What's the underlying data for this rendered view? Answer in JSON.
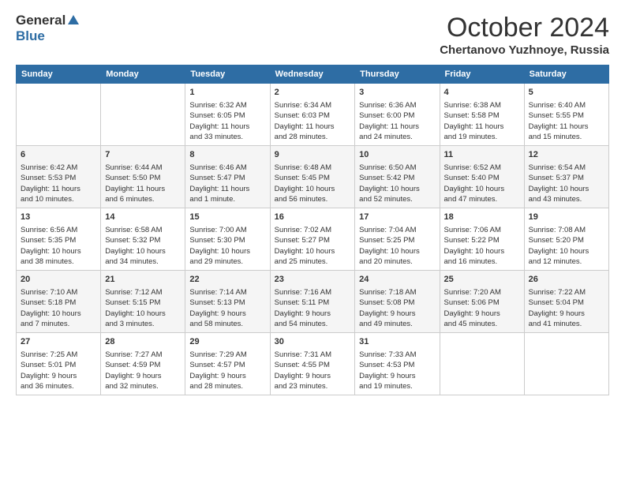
{
  "header": {
    "logo_general": "General",
    "logo_blue": "Blue",
    "month_title": "October 2024",
    "location": "Chertanovo Yuzhnoye, Russia"
  },
  "calendar": {
    "days_of_week": [
      "Sunday",
      "Monday",
      "Tuesday",
      "Wednesday",
      "Thursday",
      "Friday",
      "Saturday"
    ],
    "weeks": [
      [
        {
          "day": "",
          "info": ""
        },
        {
          "day": "",
          "info": ""
        },
        {
          "day": "1",
          "info": "Sunrise: 6:32 AM\nSunset: 6:05 PM\nDaylight: 11 hours\nand 33 minutes."
        },
        {
          "day": "2",
          "info": "Sunrise: 6:34 AM\nSunset: 6:03 PM\nDaylight: 11 hours\nand 28 minutes."
        },
        {
          "day": "3",
          "info": "Sunrise: 6:36 AM\nSunset: 6:00 PM\nDaylight: 11 hours\nand 24 minutes."
        },
        {
          "day": "4",
          "info": "Sunrise: 6:38 AM\nSunset: 5:58 PM\nDaylight: 11 hours\nand 19 minutes."
        },
        {
          "day": "5",
          "info": "Sunrise: 6:40 AM\nSunset: 5:55 PM\nDaylight: 11 hours\nand 15 minutes."
        }
      ],
      [
        {
          "day": "6",
          "info": "Sunrise: 6:42 AM\nSunset: 5:53 PM\nDaylight: 11 hours\nand 10 minutes."
        },
        {
          "day": "7",
          "info": "Sunrise: 6:44 AM\nSunset: 5:50 PM\nDaylight: 11 hours\nand 6 minutes."
        },
        {
          "day": "8",
          "info": "Sunrise: 6:46 AM\nSunset: 5:47 PM\nDaylight: 11 hours\nand 1 minute."
        },
        {
          "day": "9",
          "info": "Sunrise: 6:48 AM\nSunset: 5:45 PM\nDaylight: 10 hours\nand 56 minutes."
        },
        {
          "day": "10",
          "info": "Sunrise: 6:50 AM\nSunset: 5:42 PM\nDaylight: 10 hours\nand 52 minutes."
        },
        {
          "day": "11",
          "info": "Sunrise: 6:52 AM\nSunset: 5:40 PM\nDaylight: 10 hours\nand 47 minutes."
        },
        {
          "day": "12",
          "info": "Sunrise: 6:54 AM\nSunset: 5:37 PM\nDaylight: 10 hours\nand 43 minutes."
        }
      ],
      [
        {
          "day": "13",
          "info": "Sunrise: 6:56 AM\nSunset: 5:35 PM\nDaylight: 10 hours\nand 38 minutes."
        },
        {
          "day": "14",
          "info": "Sunrise: 6:58 AM\nSunset: 5:32 PM\nDaylight: 10 hours\nand 34 minutes."
        },
        {
          "day": "15",
          "info": "Sunrise: 7:00 AM\nSunset: 5:30 PM\nDaylight: 10 hours\nand 29 minutes."
        },
        {
          "day": "16",
          "info": "Sunrise: 7:02 AM\nSunset: 5:27 PM\nDaylight: 10 hours\nand 25 minutes."
        },
        {
          "day": "17",
          "info": "Sunrise: 7:04 AM\nSunset: 5:25 PM\nDaylight: 10 hours\nand 20 minutes."
        },
        {
          "day": "18",
          "info": "Sunrise: 7:06 AM\nSunset: 5:22 PM\nDaylight: 10 hours\nand 16 minutes."
        },
        {
          "day": "19",
          "info": "Sunrise: 7:08 AM\nSunset: 5:20 PM\nDaylight: 10 hours\nand 12 minutes."
        }
      ],
      [
        {
          "day": "20",
          "info": "Sunrise: 7:10 AM\nSunset: 5:18 PM\nDaylight: 10 hours\nand 7 minutes."
        },
        {
          "day": "21",
          "info": "Sunrise: 7:12 AM\nSunset: 5:15 PM\nDaylight: 10 hours\nand 3 minutes."
        },
        {
          "day": "22",
          "info": "Sunrise: 7:14 AM\nSunset: 5:13 PM\nDaylight: 9 hours\nand 58 minutes."
        },
        {
          "day": "23",
          "info": "Sunrise: 7:16 AM\nSunset: 5:11 PM\nDaylight: 9 hours\nand 54 minutes."
        },
        {
          "day": "24",
          "info": "Sunrise: 7:18 AM\nSunset: 5:08 PM\nDaylight: 9 hours\nand 49 minutes."
        },
        {
          "day": "25",
          "info": "Sunrise: 7:20 AM\nSunset: 5:06 PM\nDaylight: 9 hours\nand 45 minutes."
        },
        {
          "day": "26",
          "info": "Sunrise: 7:22 AM\nSunset: 5:04 PM\nDaylight: 9 hours\nand 41 minutes."
        }
      ],
      [
        {
          "day": "27",
          "info": "Sunrise: 7:25 AM\nSunset: 5:01 PM\nDaylight: 9 hours\nand 36 minutes."
        },
        {
          "day": "28",
          "info": "Sunrise: 7:27 AM\nSunset: 4:59 PM\nDaylight: 9 hours\nand 32 minutes."
        },
        {
          "day": "29",
          "info": "Sunrise: 7:29 AM\nSunset: 4:57 PM\nDaylight: 9 hours\nand 28 minutes."
        },
        {
          "day": "30",
          "info": "Sunrise: 7:31 AM\nSunset: 4:55 PM\nDaylight: 9 hours\nand 23 minutes."
        },
        {
          "day": "31",
          "info": "Sunrise: 7:33 AM\nSunset: 4:53 PM\nDaylight: 9 hours\nand 19 minutes."
        },
        {
          "day": "",
          "info": ""
        },
        {
          "day": "",
          "info": ""
        }
      ]
    ]
  }
}
